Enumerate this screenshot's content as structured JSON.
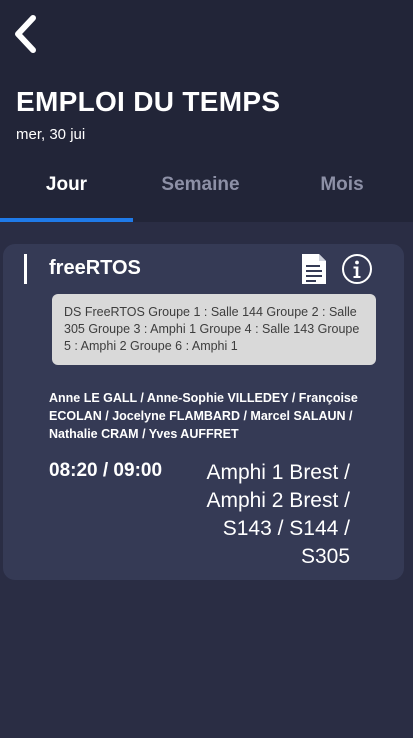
{
  "header": {
    "title": "EMPLOI DU TEMPS",
    "date": "mer, 30 jui",
    "back_icon": "chevron-left-icon"
  },
  "tabs": [
    {
      "label": "Jour",
      "active": true
    },
    {
      "label": "Semaine",
      "active": false
    },
    {
      "label": "Mois",
      "active": false
    }
  ],
  "colors": {
    "background": "#2a2d44",
    "header": "#222538",
    "card": "#353a55",
    "accent": "#1f7ae8",
    "inactive_tab": "#8d90a6",
    "description_box": "#d9d9d9"
  },
  "event": {
    "title": "freeRTOS",
    "icons": [
      "document-icon",
      "info-icon"
    ],
    "description": "DS FreeRTOS Groupe 1 : Salle 144 Groupe 2 : Salle 305 Groupe 3 : Amphi 1 Groupe 4 : Salle 143 Groupe 5 : Amphi 2 Groupe 6 : Amphi 1",
    "teachers": "Anne LE GALL / Anne-Sophie VILLEDEY / Françoise ECOLAN / Jocelyne FLAMBARD / Marcel SALAUN / Nathalie CRAM / Yves AUFFRET",
    "time": "08:20 / 09:00",
    "rooms": "Amphi 1 Brest / Amphi 2 Brest / S143 / S144 / S305"
  }
}
